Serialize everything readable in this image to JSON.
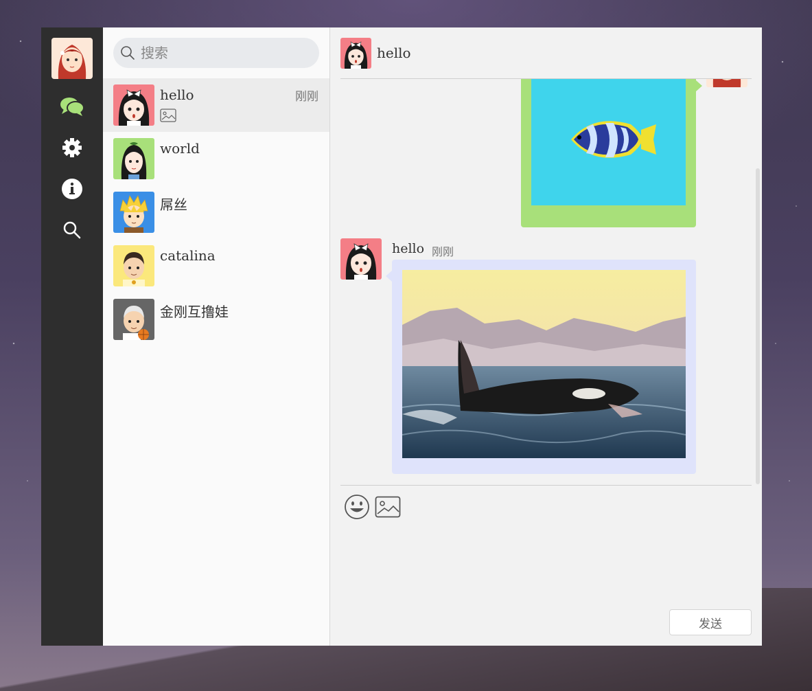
{
  "nav": {
    "items": [
      {
        "icon": "chat-bubbles-icon",
        "active": true
      },
      {
        "icon": "gear-icon"
      },
      {
        "icon": "info-icon"
      },
      {
        "icon": "search-icon"
      }
    ],
    "accent_color": "#a8e07a"
  },
  "search": {
    "placeholder": "搜索",
    "value": ""
  },
  "contacts": [
    {
      "name": "hello",
      "time": "刚刚",
      "preview": "image-icon",
      "avatar_color": "#f47e86",
      "active": true
    },
    {
      "name": "world",
      "avatar_color": "#a8e07a"
    },
    {
      "name": "屌丝",
      "avatar_color": "#3a8fe6"
    },
    {
      "name": "catalina",
      "avatar_color": "#fbe87c"
    },
    {
      "name": "金刚互撸娃",
      "avatar_color": "#666666"
    }
  ],
  "chat": {
    "title": "hello",
    "messages": [
      {
        "side": "right",
        "type": "image",
        "image": "butterflyfish",
        "bubble_color": "#a8e07a"
      },
      {
        "side": "left",
        "sender": "hello",
        "time": "刚刚",
        "type": "image",
        "image": "orca",
        "bubble_color": "#dfe3fb"
      }
    ]
  },
  "toolbar": {
    "emoji_icon": "smiley-icon",
    "image_icon": "image-icon"
  },
  "send_label": "发送"
}
